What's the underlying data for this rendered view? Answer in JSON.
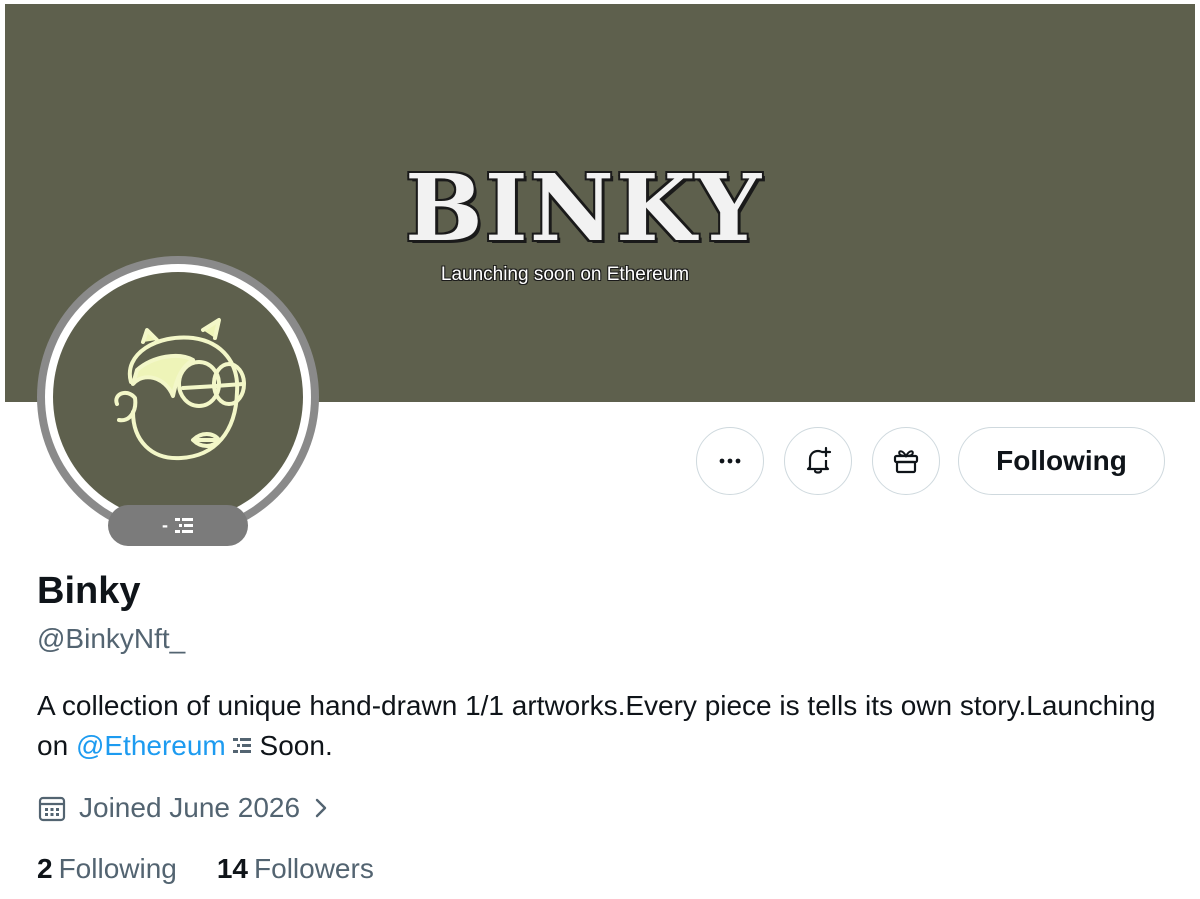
{
  "banner": {
    "logo_text": "BINKY",
    "tagline": "Launching soon on Ethereum",
    "color": "#5e604d"
  },
  "avatar": {
    "badge_text": "-",
    "badge_icon": "ethereum-icon"
  },
  "actions": {
    "more_icon": "more-icon",
    "notify_icon": "bell-plus-icon",
    "gift_icon": "gift-icon",
    "follow_label": "Following"
  },
  "profile": {
    "name": "Binky",
    "handle": "@BinkyNft_",
    "bio_part1": "A collection of unique hand-drawn 1/1 artworks.Every piece is tells its own story.Launching on ",
    "bio_mention": "@Ethereum",
    "bio_part2": " Soon.",
    "joined": "Joined June 2026"
  },
  "stats": {
    "following_count": "2",
    "following_label": "Following",
    "followers_count": "14",
    "followers_label": "Followers"
  },
  "colors": {
    "accent": "#1d9bf0",
    "secondary_text": "#536471",
    "border": "#cfd9de"
  }
}
